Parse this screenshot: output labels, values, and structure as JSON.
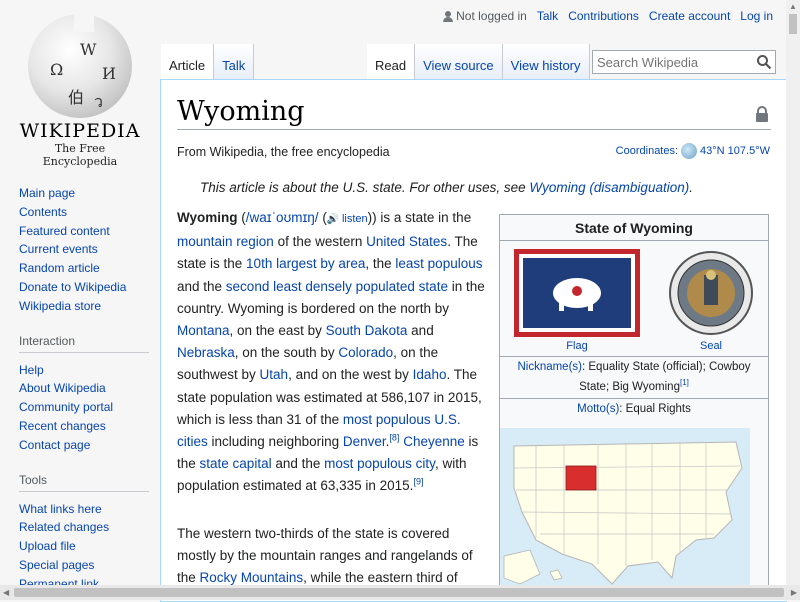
{
  "logo": {
    "wordmark": "WIKIPEDIA",
    "tagline": "The Free Encyclopedia",
    "glyphs": [
      "Ω",
      "W",
      "И",
      "伯",
      "ว"
    ]
  },
  "personal": {
    "not_logged_in": "Not logged in",
    "links": [
      "Talk",
      "Contributions",
      "Create account",
      "Log in"
    ]
  },
  "tabs": {
    "left": [
      "Article",
      "Talk"
    ],
    "right": [
      "Read",
      "View source",
      "View history"
    ]
  },
  "search": {
    "placeholder": "Search Wikipedia"
  },
  "sidebar": {
    "main": [
      "Main page",
      "Contents",
      "Featured content",
      "Current events",
      "Random article",
      "Donate to Wikipedia",
      "Wikipedia store"
    ],
    "interaction_heading": "Interaction",
    "interaction": [
      "Help",
      "About Wikipedia",
      "Community portal",
      "Recent changes",
      "Contact page"
    ],
    "tools_heading": "Tools",
    "tools": [
      "What links here",
      "Related changes",
      "Upload file",
      "Special pages",
      "Permanent link"
    ]
  },
  "article": {
    "title": "Wyoming",
    "from": "From Wikipedia, the free encyclopedia",
    "coords_label": "Coordinates:",
    "coords_value": "43°N 107.5°W",
    "hatnote_text": "This article is about the U.S. state. For other uses, see ",
    "hatnote_link": "Wyoming (disambiguation)",
    "hatnote_end": "."
  },
  "infobox": {
    "title": "State of Wyoming",
    "flag_caption": "Flag",
    "seal_caption": "Seal",
    "nickname_label": "Nickname(s)",
    "nickname_value": ": Equality State (official); Cowboy State; Big Wyoming",
    "nickname_ref": "[1]",
    "motto_label": "Motto(s)",
    "motto_value": ": Equal Rights",
    "colors": {
      "flag_blue": "#1f3d7a",
      "flag_red": "#c4262e",
      "state_red": "#d92e2e"
    }
  }
}
